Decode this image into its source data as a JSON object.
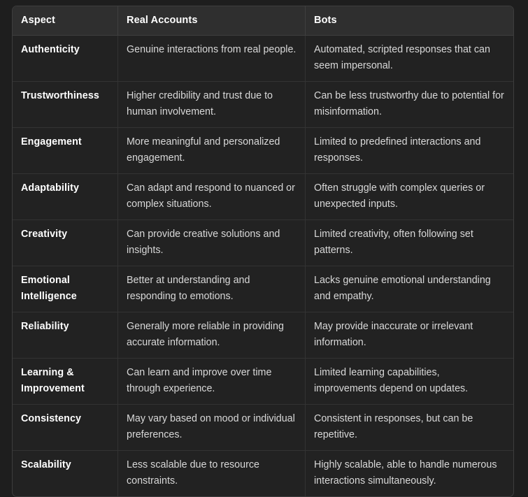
{
  "page": {
    "background_color": "#1e1e1e",
    "clipped_line_above_table": ""
  },
  "table": {
    "name": "real-accounts-vs-bots-comparison",
    "header_background": "#2f2f2f",
    "body_background": "#222222",
    "border_color": "#3d3d3d",
    "header_text_color": "#ffffff",
    "body_text_color": "#d8d8d8",
    "columns": [
      "Aspect",
      "Real Accounts",
      "Bots"
    ],
    "rows": [
      {
        "aspect": "Authenticity",
        "real_accounts": "Genuine interactions from real people.",
        "bots": "Automated, scripted responses that can seem impersonal."
      },
      {
        "aspect": "Trustworthiness",
        "real_accounts": "Higher credibility and trust due to human involvement.",
        "bots": "Can be less trustworthy due to potential for misinformation."
      },
      {
        "aspect": "Engagement",
        "real_accounts": "More meaningful and personalized engagement.",
        "bots": "Limited to predefined interactions and responses."
      },
      {
        "aspect": "Adaptability",
        "real_accounts": "Can adapt and respond to nuanced or complex situations.",
        "bots": "Often struggle with complex queries or unexpected inputs."
      },
      {
        "aspect": "Creativity",
        "real_accounts": "Can provide creative solutions and insights.",
        "bots": "Limited creativity, often following set patterns."
      },
      {
        "aspect": "Emotional Intelligence",
        "real_accounts": "Better at understanding and responding to emotions.",
        "bots": "Lacks genuine emotional understanding and empathy."
      },
      {
        "aspect": "Reliability",
        "real_accounts": "Generally more reliable in providing accurate information.",
        "bots": "May provide inaccurate or irrelevant information."
      },
      {
        "aspect": "Learning & Improvement",
        "real_accounts": "Can learn and improve over time through experience.",
        "bots": "Limited learning capabilities, improvements depend on updates."
      },
      {
        "aspect": "Consistency",
        "real_accounts": "May vary based on mood or individual preferences.",
        "bots": "Consistent in responses, but can be repetitive."
      },
      {
        "aspect": "Scalability",
        "real_accounts": "Less scalable due to resource constraints.",
        "bots": "Highly scalable, able to handle numerous interactions simultaneously."
      }
    ]
  }
}
